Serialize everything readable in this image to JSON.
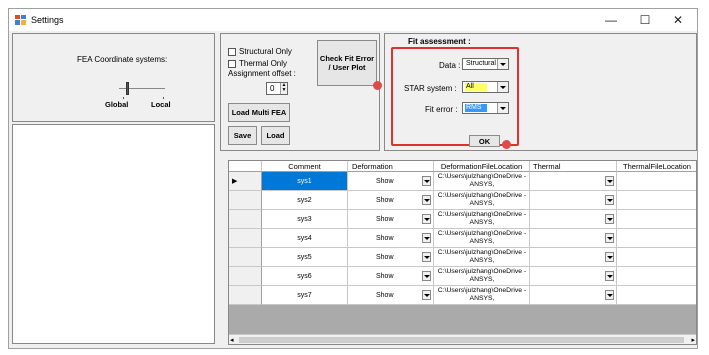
{
  "window": {
    "title": "Settings",
    "minimize": "—",
    "maximize": "☐",
    "close": "✕"
  },
  "fea_coordinate": {
    "label": "FEA Coordinate systems:",
    "global": "Global",
    "local": "Local"
  },
  "structural_only": "Structural Only",
  "thermal_only": "Thermal Only",
  "assignment_offset": {
    "label": "Assignment offset :",
    "value": "0"
  },
  "buttons": {
    "check_fit": "Check Fit Error / User Plot",
    "load_multi": "Load Multi FEA",
    "save": "Save",
    "load": "Load",
    "ok": "OK"
  },
  "fit_assessment": {
    "title": "Fit assessment :",
    "data_label": "Data :",
    "data_value": "Structural",
    "star_label": "STAR system :",
    "star_value": "All",
    "fit_label": "Fit error :",
    "fit_value": "RMS",
    "highlight_color": "#e03030",
    "star_bg": "#ffff66",
    "fit_bg": "#3399ff"
  },
  "table": {
    "headers": [
      "Comment",
      "Deformation",
      "DeformationFileLocation",
      "Thermal",
      "ThermalFileLocation"
    ],
    "rows": [
      {
        "comment": "sys1",
        "deformation": "Show",
        "path": "C:\\Users\\julzhang\\OneDrive - ANSYS,"
      },
      {
        "comment": "sys2",
        "deformation": "Show",
        "path": "C:\\Users\\julzhang\\OneDrive - ANSYS,"
      },
      {
        "comment": "sys3",
        "deformation": "Show",
        "path": "C:\\Users\\julzhang\\OneDrive - ANSYS,"
      },
      {
        "comment": "sys4",
        "deformation": "Show",
        "path": "C:\\Users\\julzhang\\OneDrive - ANSYS,"
      },
      {
        "comment": "sys5",
        "deformation": "Show",
        "path": "C:\\Users\\julzhang\\OneDrive - ANSYS,"
      },
      {
        "comment": "sys6",
        "deformation": "Show",
        "path": "C:\\Users\\julzhang\\OneDrive - ANSYS,"
      },
      {
        "comment": "sys7",
        "deformation": "Show",
        "path": "C:\\Users\\julzhang\\OneDrive - ANSYS,"
      }
    ],
    "selected_color": "#0078d7"
  }
}
